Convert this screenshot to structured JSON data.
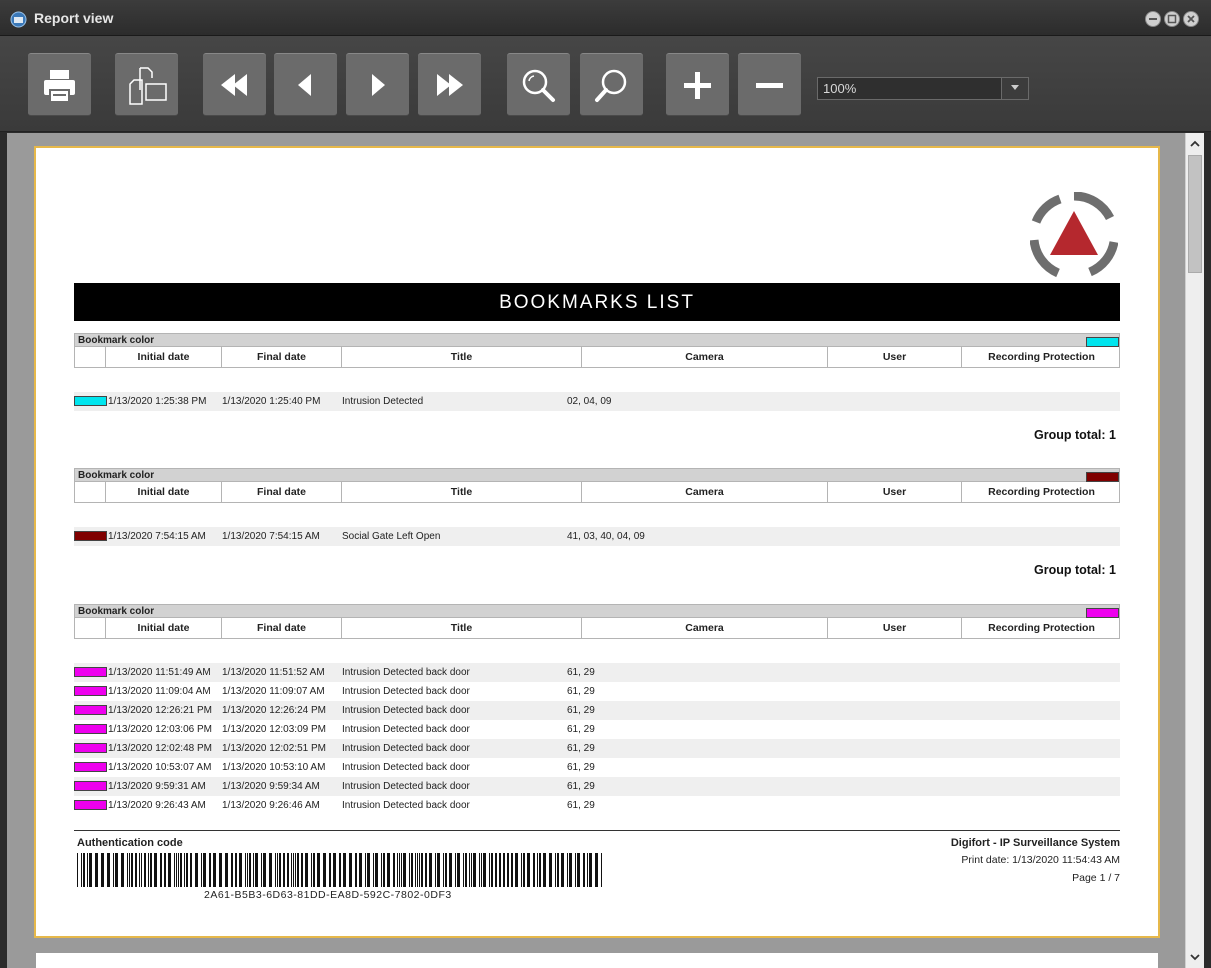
{
  "window": {
    "title": "Report view"
  },
  "toolbar": {
    "buttons": [
      "print-icon",
      "page-setup-icon",
      "first-page-icon",
      "previous-page-icon",
      "next-page-icon",
      "last-page-icon",
      "zoom-in-icon",
      "zoom-out-icon",
      "plus-icon",
      "minus-icon"
    ],
    "zoom_value": "100%"
  },
  "report": {
    "title": "BOOKMARKS LIST",
    "group_header_label": "Bookmark color",
    "columns": [
      "Initial date",
      "Final date",
      "Title",
      "Camera",
      "User",
      "Recording Protection"
    ],
    "groups": [
      {
        "color": "#00e5ee",
        "total_label": "Group total: 1",
        "rows": [
          {
            "initial": "1/13/2020 1:25:38 PM",
            "final": "1/13/2020 1:25:40 PM",
            "title": "Intrusion Detected",
            "camera": "02, 04, 09",
            "user": "",
            "protection": ""
          }
        ]
      },
      {
        "color": "#800000",
        "total_label": "Group total: 1",
        "rows": [
          {
            "initial": "1/13/2020 7:54:15 AM",
            "final": "1/13/2020 7:54:15 AM",
            "title": "Social Gate Left Open",
            "camera": "41, 03, 40, 04, 09",
            "user": "",
            "protection": ""
          }
        ]
      },
      {
        "color": "#ee00ee",
        "total_label": "",
        "rows": [
          {
            "initial": "1/13/2020 11:51:49 AM",
            "final": "1/13/2020 11:51:52 AM",
            "title": "Intrusion Detected back door",
            "camera": "61, 29",
            "user": "",
            "protection": ""
          },
          {
            "initial": "1/13/2020 11:09:04 AM",
            "final": "1/13/2020 11:09:07 AM",
            "title": "Intrusion Detected back door",
            "camera": "61, 29",
            "user": "",
            "protection": ""
          },
          {
            "initial": "1/13/2020 12:26:21 PM",
            "final": "1/13/2020 12:26:24 PM",
            "title": "Intrusion Detected back door",
            "camera": "61, 29",
            "user": "",
            "protection": ""
          },
          {
            "initial": "1/13/2020 12:03:06 PM",
            "final": "1/13/2020 12:03:09 PM",
            "title": "Intrusion Detected back door",
            "camera": "61, 29",
            "user": "",
            "protection": ""
          },
          {
            "initial": "1/13/2020 12:02:48 PM",
            "final": "1/13/2020 12:02:51 PM",
            "title": "Intrusion Detected back door",
            "camera": "61, 29",
            "user": "",
            "protection": ""
          },
          {
            "initial": "1/13/2020 10:53:07 AM",
            "final": "1/13/2020 10:53:10 AM",
            "title": "Intrusion Detected back door",
            "camera": "61, 29",
            "user": "",
            "protection": ""
          },
          {
            "initial": "1/13/2020 9:59:31 AM",
            "final": "1/13/2020 9:59:34 AM",
            "title": "Intrusion Detected back door",
            "camera": "61, 29",
            "user": "",
            "protection": ""
          },
          {
            "initial": "1/13/2020 9:26:43 AM",
            "final": "1/13/2020 9:26:46 AM",
            "title": "Intrusion Detected back door",
            "camera": "61, 29",
            "user": "",
            "protection": ""
          }
        ]
      }
    ],
    "footer": {
      "auth_label": "Authentication code",
      "auth_code": "2A61-B5B3-6D63-81DD-EA8D-592C-7802-0DF3",
      "system_name": "Digifort - IP Surveillance System",
      "print_date": "Print date: 1/13/2020 11:54:43 AM",
      "page": "Page 1 / 7"
    }
  },
  "colors": {
    "accent_border": "#e6b84a",
    "logo_red": "#b5282e",
    "logo_grey": "#6e6e6e"
  }
}
